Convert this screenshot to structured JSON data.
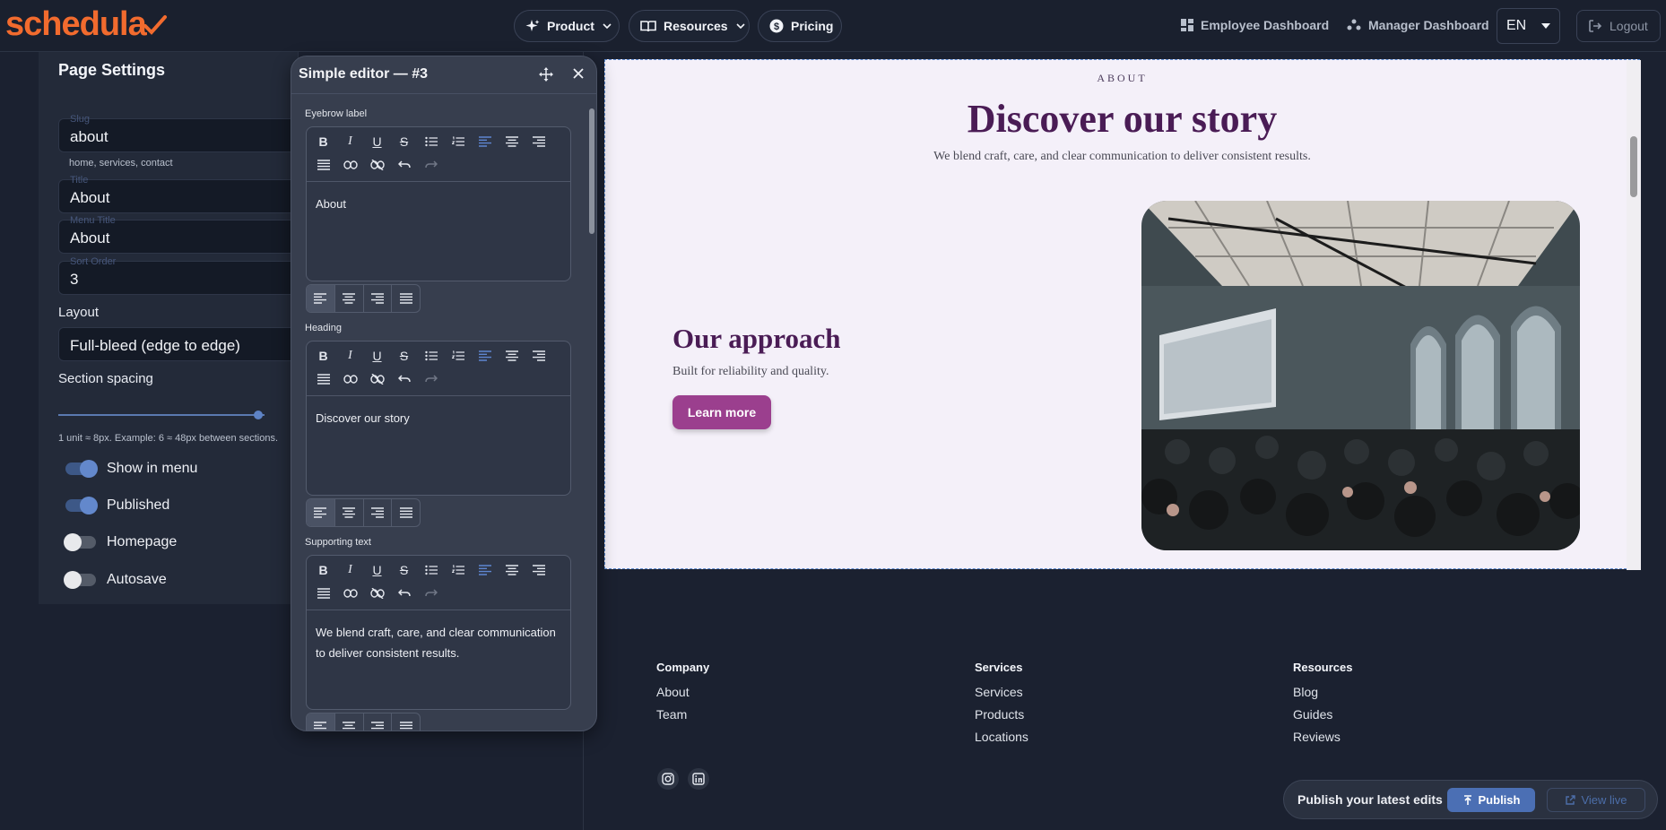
{
  "brand": {
    "name": "schedula",
    "color": "#f26b2e"
  },
  "nav": {
    "product": "Product",
    "resources": "Resources",
    "pricing": "Pricing",
    "employee_dashboard": "Employee Dashboard",
    "manager_dashboard": "Manager Dashboard",
    "language": "EN",
    "logout": "Logout"
  },
  "page_settings": {
    "title": "Page Settings",
    "slug_label": "Slug",
    "slug_value": "about",
    "slug_hint": "home, services, contact",
    "title_label": "Title",
    "title_value": "About",
    "menu_title_label": "Menu Title",
    "menu_title_value": "About",
    "sort_order_label": "Sort Order",
    "sort_order_value": "3",
    "layout_label": "Layout",
    "layout_value": "Full-bleed (edge to edge)",
    "section_spacing_label": "Section spacing",
    "section_spacing_value": 0.97,
    "spacing_hint": "1 unit ≈ 8px. Example: 6 ≈ 48px between sections.",
    "toggles": [
      {
        "label": "Show in menu",
        "on": true
      },
      {
        "label": "Published",
        "on": true
      },
      {
        "label": "Homepage",
        "on": false
      },
      {
        "label": "Autosave",
        "on": false
      }
    ]
  },
  "editor": {
    "title": "Simple editor — #3",
    "sections": [
      {
        "label": "Eyebrow label",
        "text": "About"
      },
      {
        "label": "Heading",
        "text": "Discover our story"
      },
      {
        "label": "Supporting text",
        "text": "We blend craft, care, and clear communication to deliver consistent results."
      }
    ]
  },
  "preview": {
    "eyebrow": "ABOUT",
    "title": "Discover our story",
    "subtitle": "We blend craft, care, and clear communication to deliver consistent results.",
    "heading2": "Our approach",
    "paragraph": "Built for reliability and quality.",
    "button": "Learn more",
    "accent": "#9b3f8e",
    "heading_color": "#4a1c55"
  },
  "footer": {
    "columns": [
      {
        "heading": "Company",
        "links": [
          "About",
          "Team"
        ]
      },
      {
        "heading": "Services",
        "links": [
          "Services",
          "Products",
          "Locations"
        ]
      },
      {
        "heading": "Resources",
        "links": [
          "Blog",
          "Guides",
          "Reviews"
        ]
      }
    ],
    "social": [
      "instagram-icon",
      "linkedin-icon"
    ]
  },
  "publish_bar": {
    "text": "Publish your latest edits",
    "publish": "Publish",
    "view_live": "View live"
  }
}
